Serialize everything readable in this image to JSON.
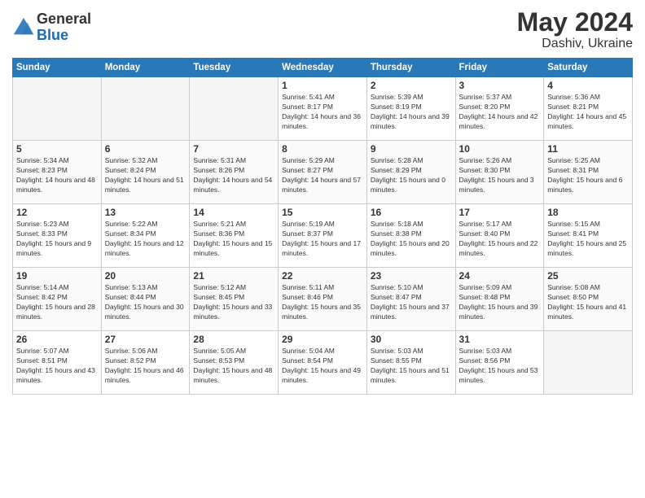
{
  "logo": {
    "general": "General",
    "blue": "Blue"
  },
  "title": {
    "month_year": "May 2024",
    "location": "Dashiv, Ukraine"
  },
  "days_of_week": [
    "Sunday",
    "Monday",
    "Tuesday",
    "Wednesday",
    "Thursday",
    "Friday",
    "Saturday"
  ],
  "weeks": [
    [
      {
        "day": "",
        "empty": true
      },
      {
        "day": "",
        "empty": true
      },
      {
        "day": "",
        "empty": true
      },
      {
        "day": "1",
        "sunrise": "5:41 AM",
        "sunset": "8:17 PM",
        "daylight": "14 hours and 36 minutes."
      },
      {
        "day": "2",
        "sunrise": "5:39 AM",
        "sunset": "8:19 PM",
        "daylight": "14 hours and 39 minutes."
      },
      {
        "day": "3",
        "sunrise": "5:37 AM",
        "sunset": "8:20 PM",
        "daylight": "14 hours and 42 minutes."
      },
      {
        "day": "4",
        "sunrise": "5:36 AM",
        "sunset": "8:21 PM",
        "daylight": "14 hours and 45 minutes."
      }
    ],
    [
      {
        "day": "5",
        "sunrise": "5:34 AM",
        "sunset": "8:23 PM",
        "daylight": "14 hours and 48 minutes."
      },
      {
        "day": "6",
        "sunrise": "5:32 AM",
        "sunset": "8:24 PM",
        "daylight": "14 hours and 51 minutes."
      },
      {
        "day": "7",
        "sunrise": "5:31 AM",
        "sunset": "8:26 PM",
        "daylight": "14 hours and 54 minutes."
      },
      {
        "day": "8",
        "sunrise": "5:29 AM",
        "sunset": "8:27 PM",
        "daylight": "14 hours and 57 minutes."
      },
      {
        "day": "9",
        "sunrise": "5:28 AM",
        "sunset": "8:29 PM",
        "daylight": "15 hours and 0 minutes."
      },
      {
        "day": "10",
        "sunrise": "5:26 AM",
        "sunset": "8:30 PM",
        "daylight": "15 hours and 3 minutes."
      },
      {
        "day": "11",
        "sunrise": "5:25 AM",
        "sunset": "8:31 PM",
        "daylight": "15 hours and 6 minutes."
      }
    ],
    [
      {
        "day": "12",
        "sunrise": "5:23 AM",
        "sunset": "8:33 PM",
        "daylight": "15 hours and 9 minutes."
      },
      {
        "day": "13",
        "sunrise": "5:22 AM",
        "sunset": "8:34 PM",
        "daylight": "15 hours and 12 minutes."
      },
      {
        "day": "14",
        "sunrise": "5:21 AM",
        "sunset": "8:36 PM",
        "daylight": "15 hours and 15 minutes."
      },
      {
        "day": "15",
        "sunrise": "5:19 AM",
        "sunset": "8:37 PM",
        "daylight": "15 hours and 17 minutes."
      },
      {
        "day": "16",
        "sunrise": "5:18 AM",
        "sunset": "8:38 PM",
        "daylight": "15 hours and 20 minutes."
      },
      {
        "day": "17",
        "sunrise": "5:17 AM",
        "sunset": "8:40 PM",
        "daylight": "15 hours and 22 minutes."
      },
      {
        "day": "18",
        "sunrise": "5:15 AM",
        "sunset": "8:41 PM",
        "daylight": "15 hours and 25 minutes."
      }
    ],
    [
      {
        "day": "19",
        "sunrise": "5:14 AM",
        "sunset": "8:42 PM",
        "daylight": "15 hours and 28 minutes."
      },
      {
        "day": "20",
        "sunrise": "5:13 AM",
        "sunset": "8:44 PM",
        "daylight": "15 hours and 30 minutes."
      },
      {
        "day": "21",
        "sunrise": "5:12 AM",
        "sunset": "8:45 PM",
        "daylight": "15 hours and 33 minutes."
      },
      {
        "day": "22",
        "sunrise": "5:11 AM",
        "sunset": "8:46 PM",
        "daylight": "15 hours and 35 minutes."
      },
      {
        "day": "23",
        "sunrise": "5:10 AM",
        "sunset": "8:47 PM",
        "daylight": "15 hours and 37 minutes."
      },
      {
        "day": "24",
        "sunrise": "5:09 AM",
        "sunset": "8:48 PM",
        "daylight": "15 hours and 39 minutes."
      },
      {
        "day": "25",
        "sunrise": "5:08 AM",
        "sunset": "8:50 PM",
        "daylight": "15 hours and 41 minutes."
      }
    ],
    [
      {
        "day": "26",
        "sunrise": "5:07 AM",
        "sunset": "8:51 PM",
        "daylight": "15 hours and 43 minutes."
      },
      {
        "day": "27",
        "sunrise": "5:06 AM",
        "sunset": "8:52 PM",
        "daylight": "15 hours and 46 minutes."
      },
      {
        "day": "28",
        "sunrise": "5:05 AM",
        "sunset": "8:53 PM",
        "daylight": "15 hours and 48 minutes."
      },
      {
        "day": "29",
        "sunrise": "5:04 AM",
        "sunset": "8:54 PM",
        "daylight": "15 hours and 49 minutes."
      },
      {
        "day": "30",
        "sunrise": "5:03 AM",
        "sunset": "8:55 PM",
        "daylight": "15 hours and 51 minutes."
      },
      {
        "day": "31",
        "sunrise": "5:03 AM",
        "sunset": "8:56 PM",
        "daylight": "15 hours and 53 minutes."
      },
      {
        "day": "",
        "empty": true
      }
    ]
  ]
}
